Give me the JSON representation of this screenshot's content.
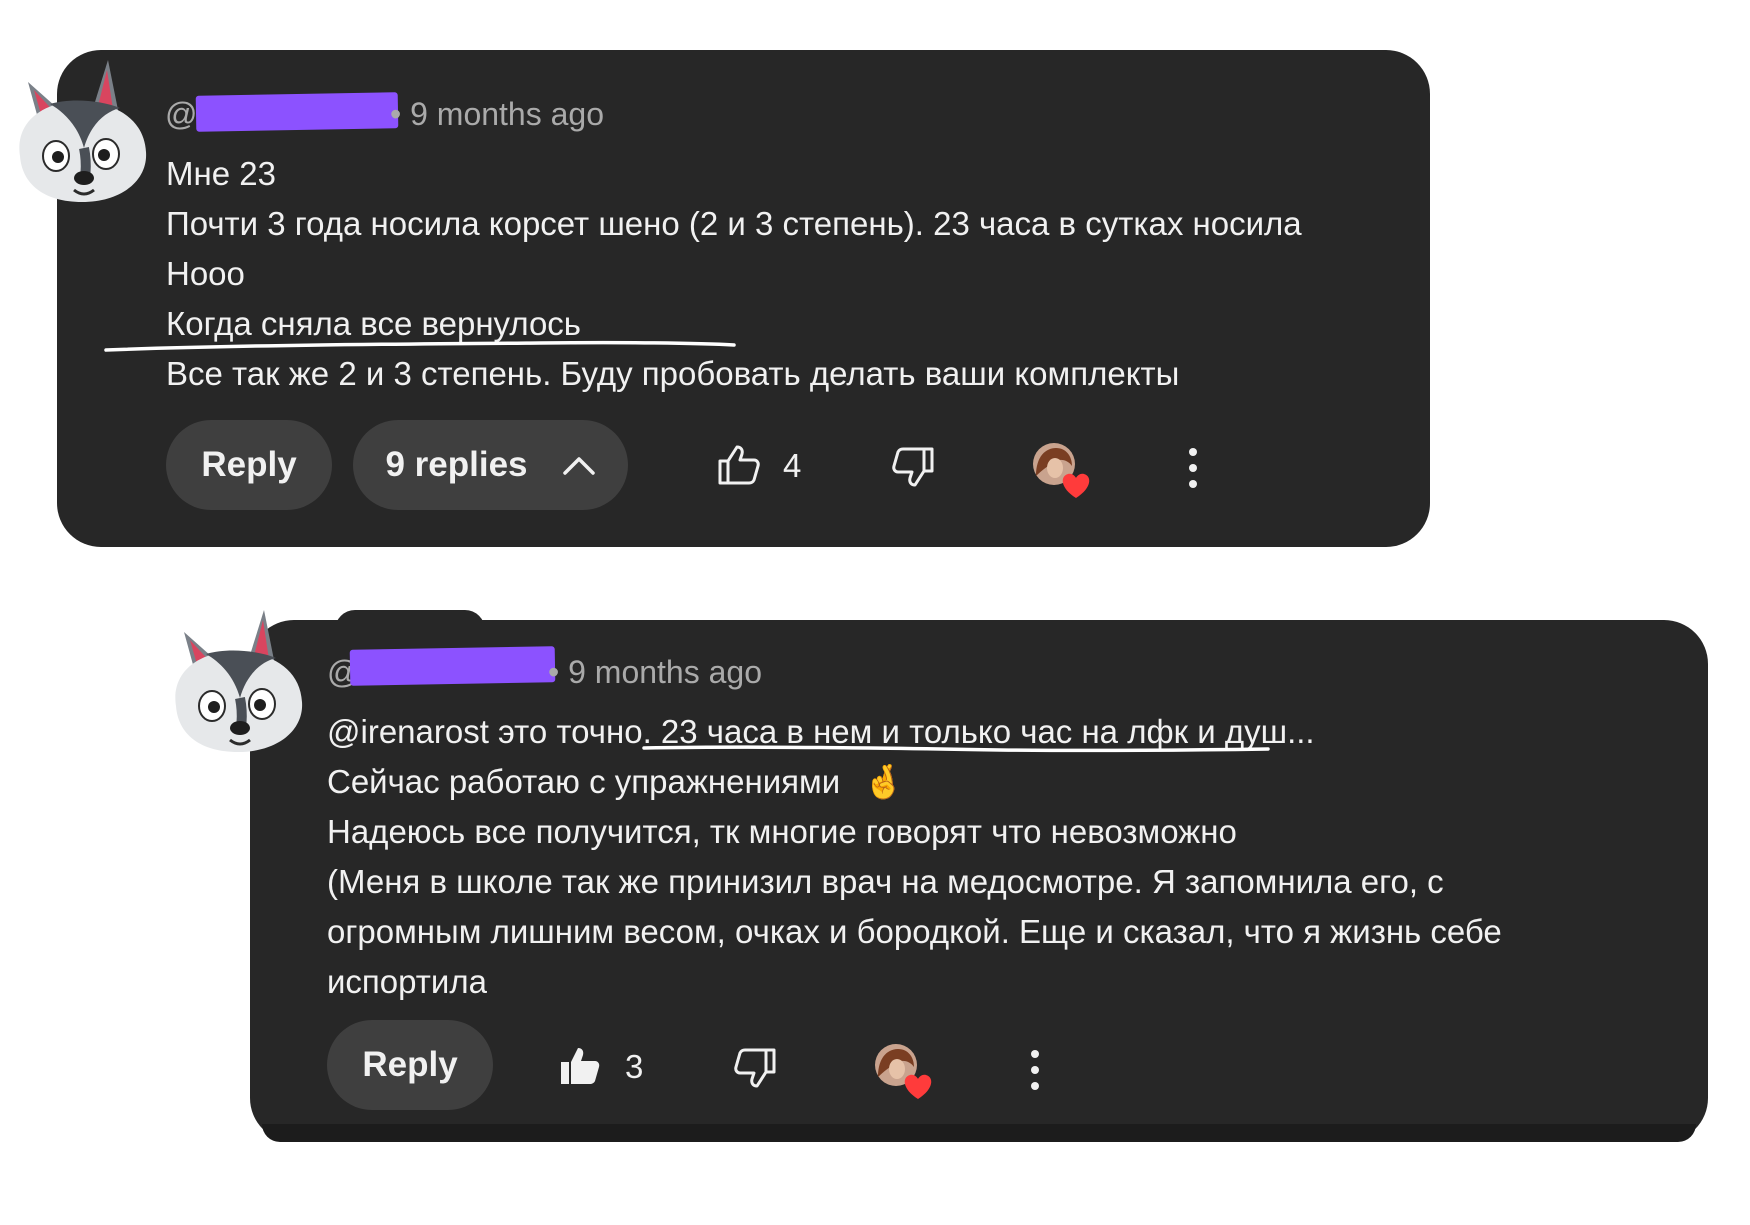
{
  "comment1": {
    "at": "@",
    "time": "9 months ago",
    "lines": [
      "Мне 23",
      "Почти 3 года носила корсет шено (2 и 3 степень). 23 часа в сутках носила",
      "Нооо",
      "Когда сняла все вернулось",
      "Все так же 2 и 3 степень. Буду пробовать делать ваши комплекты"
    ],
    "reply_label": "Reply",
    "replies_label": "9 replies",
    "likes": "4"
  },
  "comment2": {
    "at": "@",
    "time": "9 months ago",
    "line1_a": "@irenarost это точно. ",
    "line1_b": "23 часа в нем и только час на лфк и душ",
    "line1_c": "...",
    "line2": "Сейчас работаю с упражнениями",
    "line2_emoji": "🤞",
    "lines": [
      "Надеюсь все получится, тк многие говорят что невозможно",
      "(Меня в школе так же принизил врач на медосмотре. Я запомнила его, с",
      "огромным лишним весом, очках и бородкой. Еще и сказал, что я жизнь себе",
      "испортила"
    ],
    "reply_label": "Reply",
    "likes": "3"
  },
  "icons": [
    "wolf-avatar-icon",
    "thumbs-up-icon",
    "thumbs-down-icon",
    "creator-heart-icon",
    "more-vert-icon",
    "chevron-up-icon"
  ],
  "colors": {
    "card_bg": "#272727",
    "pill_bg": "#3f3f3f",
    "text": "#f1f1f1",
    "meta": "#aaaaaa",
    "redaction": "#8c52ff",
    "heart": "#ff3b3b"
  }
}
